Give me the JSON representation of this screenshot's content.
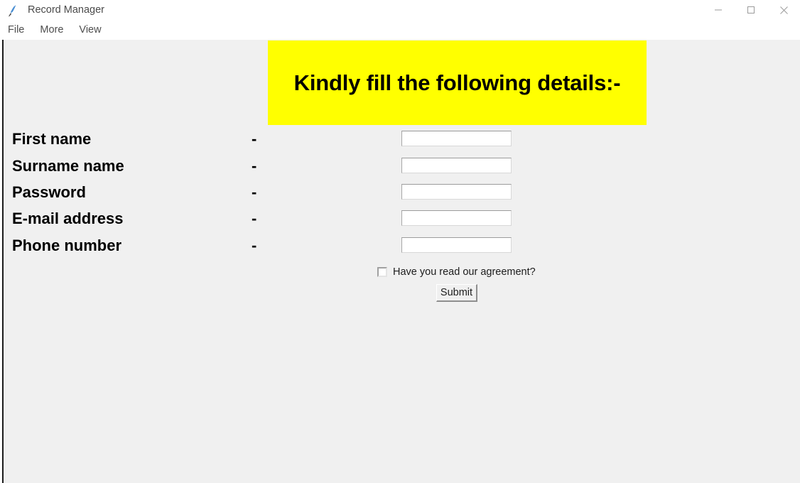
{
  "window": {
    "title": "Record Manager",
    "icon": "python-feather-icon",
    "controls": [
      {
        "name": "minimize",
        "glyph": "minimize-icon"
      },
      {
        "name": "maximize",
        "glyph": "maximize-icon"
      },
      {
        "name": "close",
        "glyph": "close-icon"
      }
    ]
  },
  "menu": {
    "items": [
      {
        "label": "File"
      },
      {
        "label": "More"
      },
      {
        "label": "View"
      }
    ]
  },
  "banner": {
    "text": "Kindly fill the following details:-",
    "background_color": "#ffff00",
    "text_color": "#000000"
  },
  "form": {
    "separator": "-",
    "fields": [
      {
        "label": "First name",
        "value": "",
        "placeholder": ""
      },
      {
        "label": "Surname name",
        "value": "",
        "placeholder": ""
      },
      {
        "label": "Password",
        "value": "",
        "placeholder": ""
      },
      {
        "label": "E-mail address",
        "value": "",
        "placeholder": ""
      },
      {
        "label": "Phone number",
        "value": "",
        "placeholder": ""
      }
    ],
    "agreement": {
      "label": "Have you read our agreement?",
      "checked": false
    },
    "submit_label": "Submit"
  },
  "colors": {
    "title_bar": "#ffffff",
    "client_background": "#f0f0f0",
    "banner": "#ffff00",
    "text": "#000000",
    "menu_text": "#4e4e4e"
  }
}
